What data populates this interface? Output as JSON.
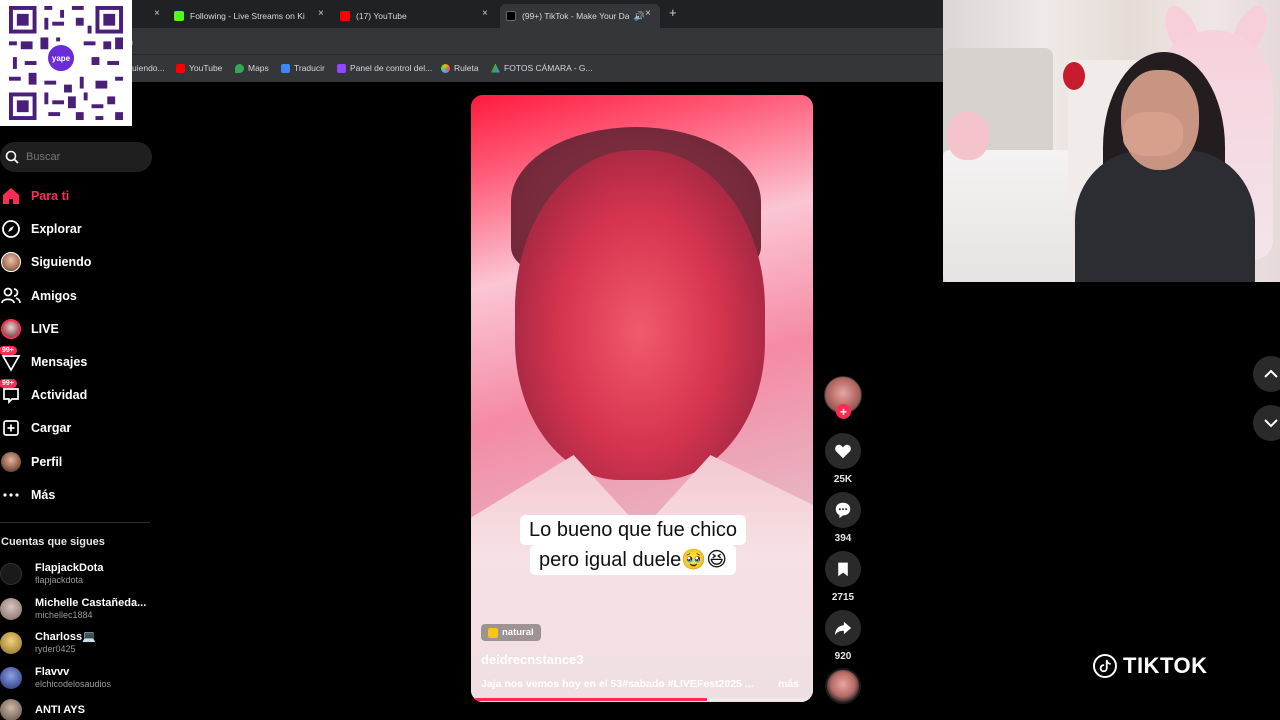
{
  "browser": {
    "tabs": [
      {
        "title": "Following - Live Streams on Ki",
        "favicon_color": "#53fc18",
        "active": false
      },
      {
        "title": "(17) YouTube",
        "favicon_color": "#ff0000",
        "active": false
      },
      {
        "title": "(99+) TikTok - Make Your Da",
        "favicon_color": "#000000",
        "active": true
      }
    ],
    "new_tab_label": "+",
    "close_label": "×",
    "address_fragment": "n",
    "bookmarks": [
      {
        "label": "uiendo...",
        "color": "#888888"
      },
      {
        "label": "YouTube",
        "color": "#ff0000"
      },
      {
        "label": "Maps",
        "color": "#34a853"
      },
      {
        "label": "Traducir",
        "color": "#4285f4"
      },
      {
        "label": "Panel de control del...",
        "color": "#9146ff"
      },
      {
        "label": "Ruleta",
        "color": "#e6b800"
      },
      {
        "label": "FOTOS CÁMARA - G...",
        "color": "#fbbc04"
      }
    ]
  },
  "qr": {
    "badge_label": "yape",
    "badge_color": "#6c2bd9"
  },
  "search": {
    "placeholder": "Buscar"
  },
  "nav": [
    {
      "label": "Para ti",
      "icon": "home-icon",
      "active": true
    },
    {
      "label": "Explorar",
      "icon": "compass-icon"
    },
    {
      "label": "Siguiendo",
      "icon": "following-avatar-icon"
    },
    {
      "label": "Amigos",
      "icon": "friends-icon"
    },
    {
      "label": "LIVE",
      "icon": "live-icon"
    },
    {
      "label": "Mensajes",
      "icon": "messages-icon",
      "badge": "99+"
    },
    {
      "label": "Actividad",
      "icon": "activity-icon",
      "badge": "99+"
    },
    {
      "label": "Cargar",
      "icon": "upload-icon"
    },
    {
      "label": "Perfil",
      "icon": "profile-icon"
    },
    {
      "label": "Más",
      "icon": "more-icon"
    }
  ],
  "following": {
    "heading": "Cuentas que sigues",
    "accounts": [
      {
        "name": "FlapjackDota",
        "handle": "flapjackdota",
        "color": "#222222"
      },
      {
        "name": "Michelle Castañeda...",
        "handle": "michellec1884",
        "color": "#9b8a88"
      },
      {
        "name": "Charloss💻",
        "handle": "ryder0425",
        "color": "#c9a04a"
      },
      {
        "name": "Flavvv",
        "handle": "elchicodelosaudios",
        "color": "#3f4b8c"
      },
      {
        "name": "ANTI AYS",
        "handle": "",
        "color": "#8d7a6a"
      }
    ]
  },
  "video": {
    "caption_line1": "Lo bueno que fue chico",
    "caption_line2": "pero igual duele🥹😆",
    "tag": "natural",
    "author": "deidrecnstance3",
    "description": "Jaja nos vemos hoy en el 53#sabado #LIVEFest2025 ...",
    "more_label": "más",
    "progress_fraction": 0.69
  },
  "actions": {
    "follow_label": "+",
    "likes": "25K",
    "comments": "394",
    "saves": "2715",
    "shares": "920"
  },
  "brand": {
    "logo_text": "TIKTOK",
    "accent": "#fe2c55"
  }
}
